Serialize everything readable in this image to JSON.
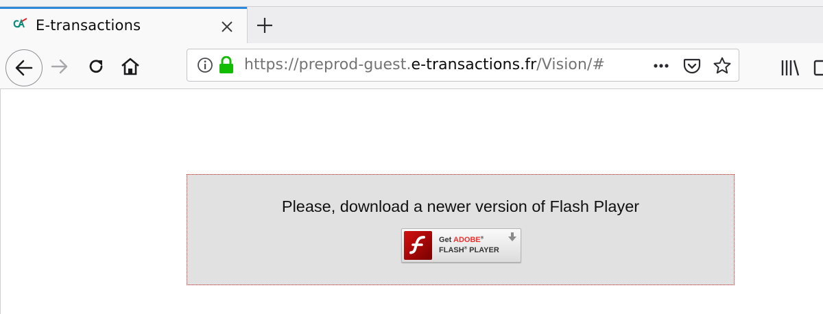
{
  "tab": {
    "title": "E-transactions",
    "favicon": "ca-bank-icon",
    "accent_color": "#2f88d8"
  },
  "navbar": {
    "url_prefix": "https://preprod-guest.",
    "url_host": "e-transactions.fr",
    "url_path": "/Vision/#"
  },
  "page": {
    "message": "Please, download a newer version of Flash Player",
    "badge": {
      "get": "Get",
      "adobe": "ADOBE",
      "product": "FLASH",
      "player": "PLAYER",
      "reg": "®"
    }
  },
  "colors": {
    "lock_green": "#12bc00",
    "flash_box_bg": "#e1e1e1",
    "flash_box_border": "#e02020"
  }
}
